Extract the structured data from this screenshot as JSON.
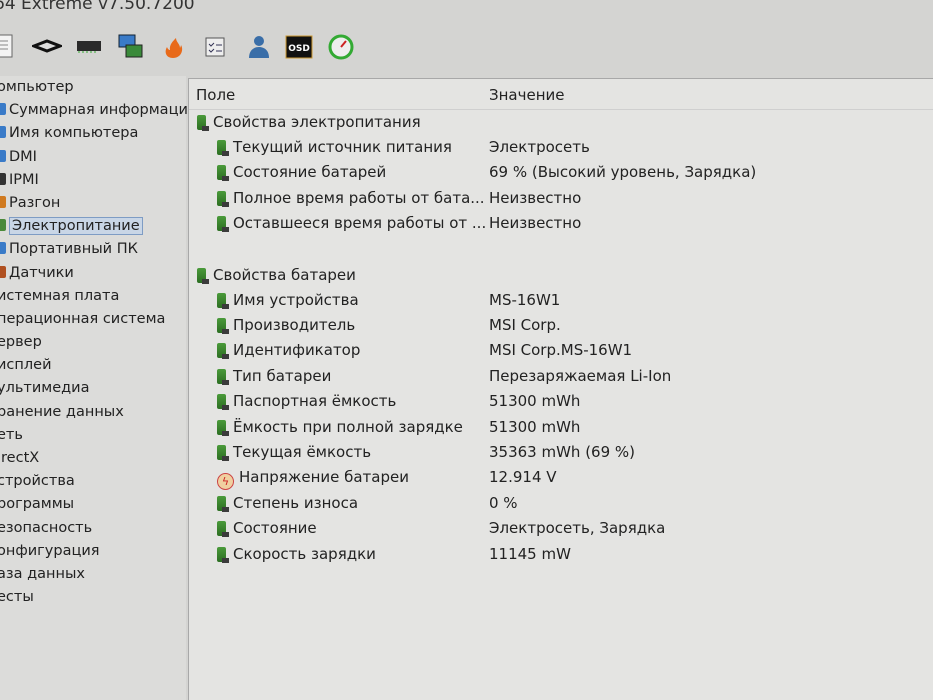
{
  "window": {
    "title": "64 Extreme v7.50.7200"
  },
  "toolbar": [
    {
      "icon": "report-icon"
    },
    {
      "icon": "cpu-icon"
    },
    {
      "icon": "memory-icon"
    },
    {
      "icon": "motherboard-icon"
    },
    {
      "icon": "stress-test-flame-icon"
    },
    {
      "icon": "audit-checklist-icon"
    },
    {
      "icon": "users-icon"
    },
    {
      "icon": "osd-icon",
      "label": "OSD"
    },
    {
      "icon": "gauge-icon"
    }
  ],
  "tree": [
    {
      "label": "омпьютер",
      "level": 0
    },
    {
      "label": "Суммарная информаци",
      "level": 1,
      "color": "#3a7bc8"
    },
    {
      "label": "Имя компьютера",
      "level": 1,
      "color": "#3a7bc8"
    },
    {
      "label": "DMI",
      "level": 1,
      "color": "#3a7bc8"
    },
    {
      "label": "IPMI",
      "level": 1,
      "color": "#333"
    },
    {
      "label": "Разгон",
      "level": 1,
      "color": "#d07a20"
    },
    {
      "label": "Электропитание",
      "level": 1,
      "color": "#4a8a3a",
      "selected": true
    },
    {
      "label": "Портативный ПК",
      "level": 1,
      "color": "#3a7bc8"
    },
    {
      "label": "Датчики",
      "level": 1,
      "color": "#b05020"
    },
    {
      "label": "истемная плата",
      "level": 0
    },
    {
      "label": "перационная система",
      "level": 0
    },
    {
      "label": "ервер",
      "level": 0
    },
    {
      "label": "исплей",
      "level": 0
    },
    {
      "label": "ультимедиа",
      "level": 0
    },
    {
      "label": "ранение данных",
      "level": 0
    },
    {
      "label": "еть",
      "level": 0
    },
    {
      "label": "irectX",
      "level": 0
    },
    {
      "label": "стройства",
      "level": 0
    },
    {
      "label": "рограммы",
      "level": 0
    },
    {
      "label": "езопасность",
      "level": 0
    },
    {
      "label": "онфигурация",
      "level": 0
    },
    {
      "label": "аза данных",
      "level": 0
    },
    {
      "label": "есты",
      "level": 0
    }
  ],
  "columns": {
    "field": "Поле",
    "value": "Значение"
  },
  "sections": [
    {
      "title": "Свойства электропитания",
      "rows": [
        {
          "field": "Текущий источник питания",
          "value": "Электросеть"
        },
        {
          "field": "Состояние батарей",
          "value": "69 % (Высокий уровень, Зарядка)"
        },
        {
          "field": "Полное время работы от бата...",
          "value": "Неизвестно"
        },
        {
          "field": "Оставшееся время работы от ...",
          "value": "Неизвестно"
        }
      ]
    },
    {
      "title": "Свойства батареи",
      "rows": [
        {
          "field": "Имя устройства",
          "value": "MS-16W1"
        },
        {
          "field": "Производитель",
          "value": "MSI Corp."
        },
        {
          "field": "Идентификатор",
          "value": "MSI Corp.MS-16W1"
        },
        {
          "field": "Тип батареи",
          "value": "Перезаряжаемая Li-Ion"
        },
        {
          "field": "Паспортная ёмкость",
          "value": "51300 mWh"
        },
        {
          "field": "Ёмкость при полной зарядке",
          "value": "51300 mWh"
        },
        {
          "field": "Текущая ёмкость",
          "value": "35363 mWh  (69 %)"
        },
        {
          "field": "Напряжение батареи",
          "value": "12.914 V",
          "icon": "voltage-icon"
        },
        {
          "field": "Степень износа",
          "value": "0 %"
        },
        {
          "field": "Состояние",
          "value": "Электросеть, Зарядка"
        },
        {
          "field": "Скорость зарядки",
          "value": "11145 mW"
        }
      ]
    }
  ]
}
